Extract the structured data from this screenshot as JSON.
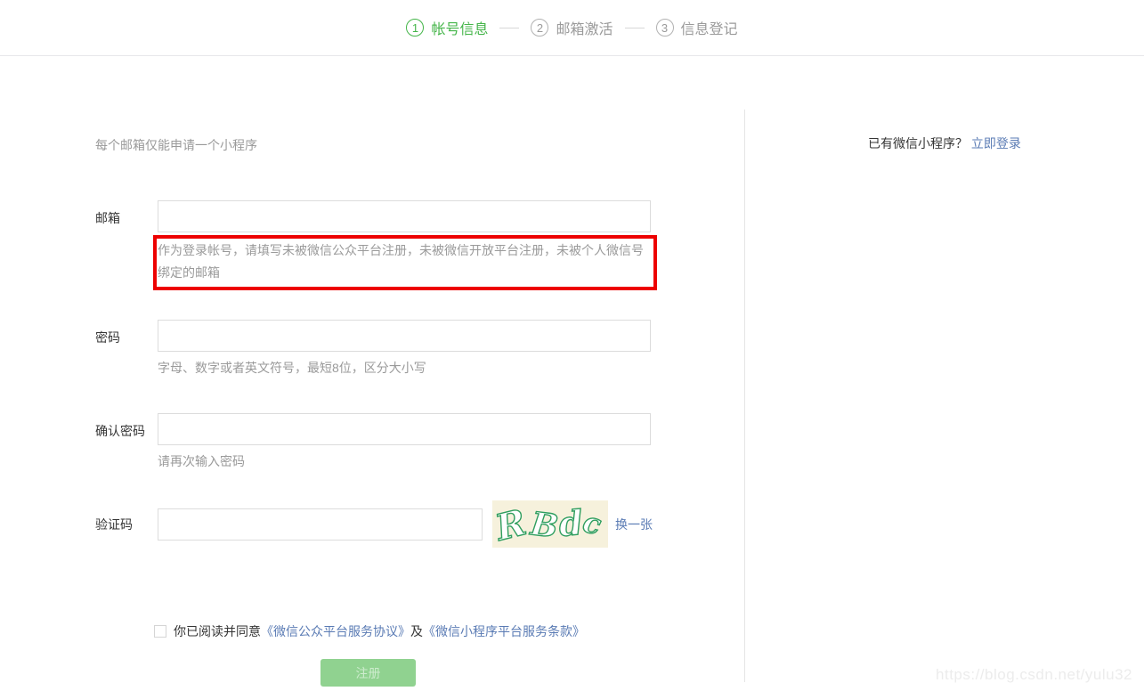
{
  "colors": {
    "accent_green": "#44b549",
    "link_blue": "#5a7bb4",
    "annotation_red": "#ed0000",
    "button_disabled_bg": "#90d290",
    "button_disabled_text": "#cdeccd",
    "captcha_bg": "#f6f1dc",
    "captcha_stroke": "#2f9e5f",
    "hint_gray": "#9a9a9a"
  },
  "stepper": {
    "steps": [
      {
        "number": "1",
        "label": "帐号信息",
        "active": true
      },
      {
        "number": "2",
        "label": "邮箱激活",
        "active": false
      },
      {
        "number": "3",
        "label": "信息登记",
        "active": false
      }
    ]
  },
  "form": {
    "intro": "每个邮箱仅能申请一个小程序",
    "email": {
      "label": "邮箱",
      "value": "",
      "placeholder": "",
      "hint": "作为登录帐号，请填写未被微信公众平台注册，未被微信开放平台注册，未被个人微信号绑定的邮箱"
    },
    "password": {
      "label": "密码",
      "value": "",
      "placeholder": "",
      "hint": "字母、数字或者英文符号，最短8位，区分大小写"
    },
    "confirm_password": {
      "label": "确认密码",
      "value": "",
      "placeholder": "",
      "hint": "请再次输入密码"
    },
    "captcha": {
      "label": "验证码",
      "value": "",
      "placeholder": "",
      "image_text": "RBdc",
      "chars": [
        "R",
        "B",
        "d",
        "c"
      ],
      "refresh_label": "换一张"
    },
    "agreement": {
      "checked": false,
      "prefix": "你已阅读并同意",
      "link1": "《微信公众平台服务协议》",
      "conjunction": "及",
      "link2": "《微信小程序平台服务条款》"
    },
    "submit_label": "注册"
  },
  "side_panel": {
    "question": "已有微信小程序？",
    "login_link": "立即登录"
  },
  "watermark": "https://blog.csdn.net/yulu32"
}
